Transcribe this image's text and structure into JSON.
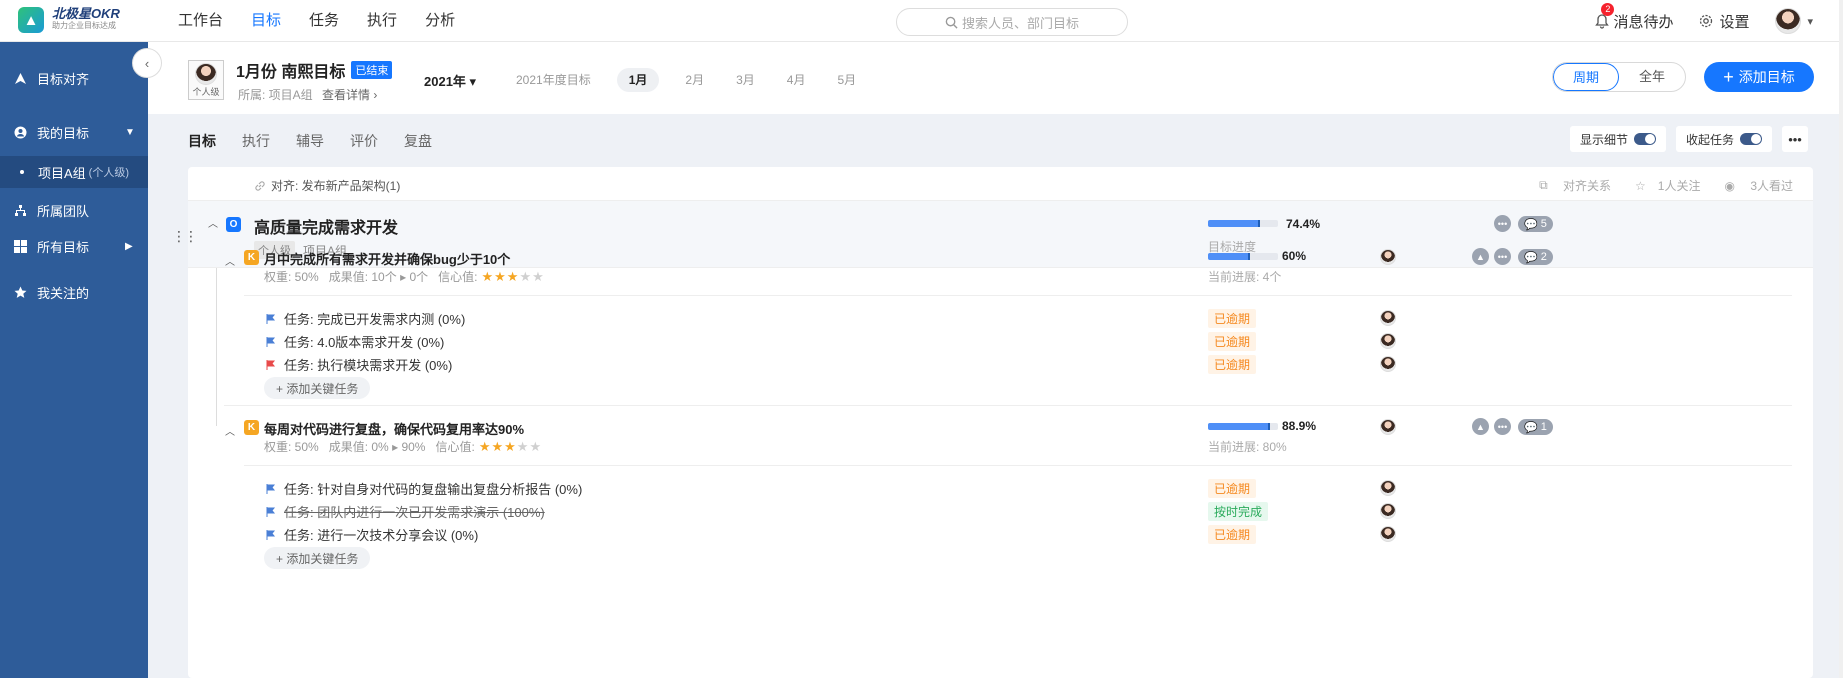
{
  "logo": {
    "name": "北极星OKR",
    "slogan": "助力企业目标达成"
  },
  "nav": [
    "工作台",
    "目标",
    "任务",
    "执行",
    "分析"
  ],
  "nav_active": 1,
  "search": {
    "placeholder": "搜索人员、部门目标"
  },
  "top_right": {
    "notifications_label": "消息待办",
    "notifications_count": "2",
    "settings_label": "设置"
  },
  "sidebar": {
    "items": [
      {
        "label": "目标对齐",
        "icon": "align-icon"
      },
      {
        "label": "我的目标",
        "icon": "user-circle-icon"
      },
      {
        "label": "项目A组",
        "tag": "(个人级)"
      },
      {
        "label": "所属团队",
        "icon": "team-icon"
      },
      {
        "label": "所有目标",
        "icon": "grid-icon"
      },
      {
        "label": "我关注的",
        "icon": "star-icon"
      }
    ]
  },
  "header": {
    "avatar_label": "个人级",
    "title": "1月份 南熙目标",
    "status": "已结束",
    "belongs": "所属: 项目A组",
    "detail_link": "查看详情",
    "year": "2021年",
    "periods": [
      "2021年度目标",
      "1月",
      "2月",
      "3月",
      "4月",
      "5月"
    ],
    "active_period": 1,
    "view_modes": [
      "周期",
      "全年"
    ],
    "add_goal": "添加目标"
  },
  "tabs": [
    "目标",
    "执行",
    "辅导",
    "评价",
    "复盘"
  ],
  "toggles": {
    "show_detail": "显示细节",
    "collapse_tasks": "收起任务"
  },
  "alignment": {
    "text": "对齐: 发布新产品架构(1)",
    "relation": "对齐关系",
    "followers": "1人关注",
    "viewers": "3人看过"
  },
  "objective": {
    "title": "高质量完成需求开发",
    "level_tag": "个人级",
    "group": "项目A组",
    "progress_text": "74.4%",
    "progress": 0.744,
    "progress_label": "目标进度",
    "comments": "5"
  },
  "key_results": [
    {
      "title": "月中完成所有需求开发并确保bug少于10个",
      "weight": "权重: 50%",
      "result": "成果值: 10个",
      "result_to": "0个",
      "confidence_label": "信心值:",
      "stars": 3,
      "progress_text": "60%",
      "progress": 0.6,
      "current": "当前进展: 4个",
      "comments": "2",
      "tasks": [
        {
          "text": "任务: 完成已开发需求内测 (0%)",
          "flag": "#4a7fd6",
          "status": "已逾期",
          "type": "overdue",
          "done": false
        },
        {
          "text": "任务: 4.0版本需求开发 (0%)",
          "flag": "#4a7fd6",
          "status": "已逾期",
          "type": "overdue",
          "done": false
        },
        {
          "text": "任务: 执行模块需求开发 (0%)",
          "flag": "#e84a4a",
          "status": "已逾期",
          "type": "overdue",
          "done": false
        }
      ],
      "add_task": "+ 添加关键任务"
    },
    {
      "title": "每周对代码进行复盘，确保代码复用率达90%",
      "weight": "权重: 50%",
      "result": "成果值: 0%",
      "result_to": "90%",
      "confidence_label": "信心值:",
      "stars": 3,
      "progress_text": "88.9%",
      "progress": 0.889,
      "current": "当前进展: 80%",
      "comments": "1",
      "tasks": [
        {
          "text": "任务: 针对自身对代码的复盘输出复盘分析报告 (0%)",
          "flag": "#4a7fd6",
          "status": "已逾期",
          "type": "overdue",
          "done": false
        },
        {
          "text": "任务: 团队内进行一次已开发需求演示 (100%)",
          "flag": "#4a7fd6",
          "status": "按时完成",
          "type": "ontime",
          "done": true
        },
        {
          "text": "任务: 进行一次技术分享会议 (0%)",
          "flag": "#4a7fd6",
          "status": "已逾期",
          "type": "overdue",
          "done": false
        }
      ],
      "add_task": "+ 添加关键任务"
    }
  ],
  "colors": {
    "accent": "#1677ff",
    "sidebar": "#2e5c99",
    "overdue": "#f5891f",
    "ontime": "#2bab5c"
  }
}
